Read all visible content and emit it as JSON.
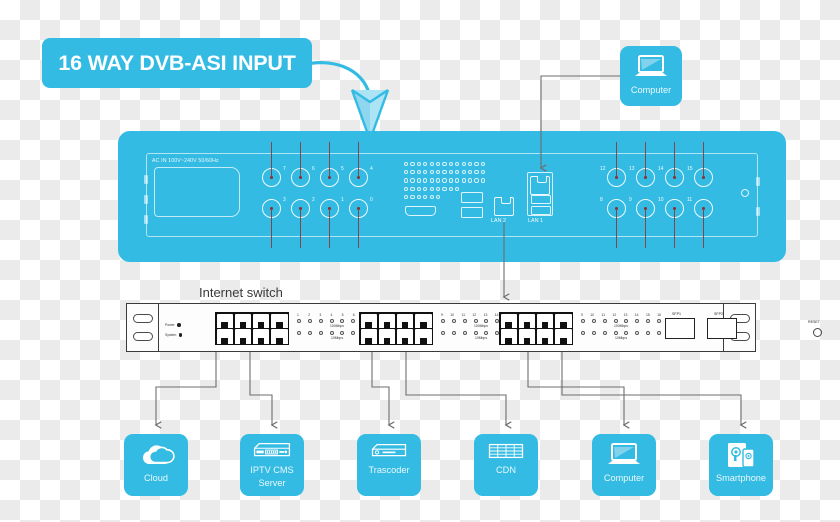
{
  "banner": {
    "text": "16 WAY DVB-ASI INPUT"
  },
  "colors": {
    "brand_cyan": "#33bbe3",
    "cable_red": "#8d3535",
    "wire_gray": "#6e6e6e",
    "panel_white": "#fdfdfd",
    "outline_dark": "#3b3b3b"
  },
  "main_device": {
    "name": "dvb-asi-chassis",
    "ac_label": "AC IN 100V~240V 50/60Hz",
    "lan_labels": [
      "LAN 2",
      "LAN 1"
    ],
    "bnc_top_left": [
      "7",
      "6",
      "5",
      "4"
    ],
    "bnc_bottom_left": [
      "3",
      "2",
      "1",
      "0"
    ],
    "bnc_top_right": [
      "12",
      "13",
      "14",
      "15"
    ],
    "bnc_bottom_right": [
      "8",
      "9",
      "10",
      "11"
    ]
  },
  "switch": {
    "title": "Internet switch",
    "status_leds": [
      {
        "label": "Power"
      },
      {
        "label": "System"
      }
    ],
    "port_led_numbers": [
      "1",
      "2",
      "3",
      "4",
      "5",
      "6",
      "7",
      "8"
    ],
    "port_led_numbers_right": [
      "9",
      "10",
      "11",
      "12",
      "13",
      "14",
      "15",
      "16"
    ],
    "led_caption_top": "100Mbps",
    "led_caption_bottom": "10Mbps",
    "sfp_labels": [
      "SFP1",
      "SFP2"
    ],
    "reset_label": "RESET"
  },
  "top_node": {
    "label": "Computer",
    "icon": "laptop-icon"
  },
  "endpoints": [
    {
      "id": "cloud",
      "label": "Cloud",
      "icon": "cloud-icon"
    },
    {
      "id": "iptv",
      "label": "IPTV CMS\nServer",
      "label_line1": "IPTV CMS",
      "label_line2": "Server",
      "icon": "rack-server-icon"
    },
    {
      "id": "trascoder",
      "label": "Trascoder",
      "icon": "set-top-box-icon"
    },
    {
      "id": "cdn",
      "label": "CDN",
      "icon": "server-stack-icon"
    },
    {
      "id": "computer",
      "label": "Computer",
      "icon": "laptop-icon"
    },
    {
      "id": "smartphone",
      "label": "Smartphone",
      "icon": "tablet-phone-icon"
    }
  ]
}
